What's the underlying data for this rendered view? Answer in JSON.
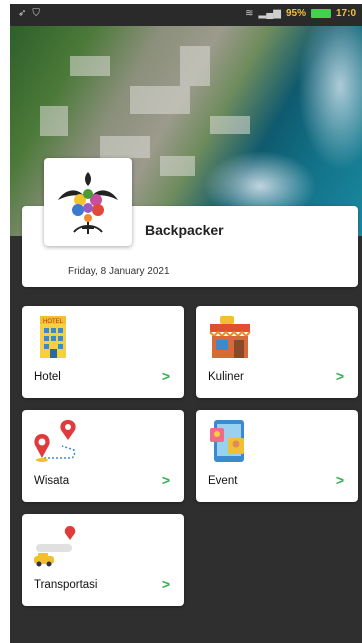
{
  "status_bar": {
    "battery_percent": "95%",
    "time": "17:0"
  },
  "profile": {
    "name": "Backpacker",
    "date": "Friday, 8 January 2021",
    "logo_icon": "batik-crest-icon"
  },
  "menu": [
    {
      "label": "Hotel",
      "icon": "hotel-building-icon"
    },
    {
      "label": "Kuliner",
      "icon": "food-stall-icon"
    },
    {
      "label": "Wisata",
      "icon": "map-pins-route-icon"
    },
    {
      "label": "Event",
      "icon": "phone-event-icon"
    },
    {
      "label": "Transportasi",
      "icon": "taxi-location-icon"
    }
  ],
  "colors": {
    "background": "#2f2f2f",
    "card": "#ffffff",
    "chevron": "#2eb24d"
  }
}
